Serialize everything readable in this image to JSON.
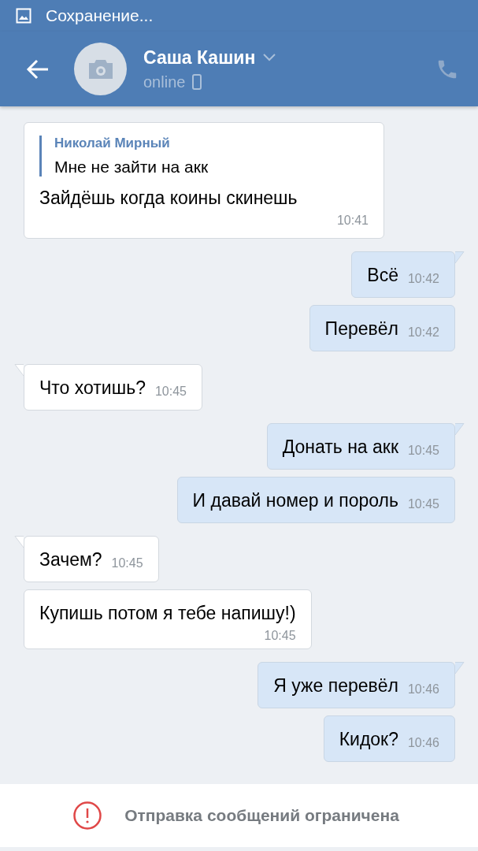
{
  "status_bar": {
    "notification": "Сохранение..."
  },
  "header": {
    "name": "Саша Кашин",
    "status": "online"
  },
  "messages": [
    {
      "kind": "incoming",
      "tail": false,
      "quote": {
        "author": "Николай Мирный",
        "text": "Мне не зайти на акк"
      },
      "text": "Зайдёшь когда коины скинешь",
      "time": "10:41"
    },
    {
      "kind": "outgoing",
      "tail": true,
      "text": "Всё",
      "time": "10:42"
    },
    {
      "kind": "outgoing",
      "tail": false,
      "text": "Перевёл",
      "time": "10:42"
    },
    {
      "kind": "incoming",
      "tail": true,
      "text": "Что хотишь?",
      "time": "10:45"
    },
    {
      "kind": "outgoing",
      "tail": true,
      "text": "Донать на акк",
      "time": "10:45"
    },
    {
      "kind": "outgoing",
      "tail": false,
      "text": "И давай номер и пороль",
      "time": "10:45"
    },
    {
      "kind": "incoming",
      "tail": true,
      "text": "Зачем?",
      "time": "10:45"
    },
    {
      "kind": "incoming",
      "tail": false,
      "text": "Купишь потом я тебе напишу!)",
      "time": "10:45",
      "time_below": true
    },
    {
      "kind": "outgoing",
      "tail": true,
      "text": "Я уже перевёл",
      "time": "10:46"
    },
    {
      "kind": "outgoing",
      "tail": false,
      "text": "Кидок?",
      "time": "10:46"
    }
  ],
  "footer": {
    "notice": "Отправка сообщений ограничена"
  }
}
